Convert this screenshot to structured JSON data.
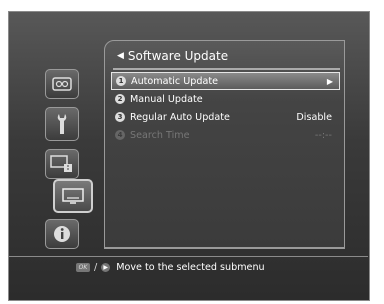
{
  "panel": {
    "title": "Software Update"
  },
  "menu": {
    "items": [
      {
        "num": "1",
        "label": "Automatic Update",
        "value": "▶"
      },
      {
        "num": "2",
        "label": "Manual Update",
        "value": ""
      },
      {
        "num": "3",
        "label": "Regular Auto Update",
        "value": "Disable"
      },
      {
        "num": "4",
        "label": "Search Time",
        "value": "--:--"
      }
    ]
  },
  "categories": [
    {
      "icon": "video-icon"
    },
    {
      "icon": "wrench-icon"
    },
    {
      "icon": "network-icon"
    },
    {
      "icon": "tv-icon"
    },
    {
      "icon": "info-icon"
    }
  ],
  "hint": {
    "ok": "OK",
    "slash": "/",
    "right": "▶",
    "text": "Move to the selected submenu"
  },
  "colors": {
    "background": "#3a3a3a",
    "highlight": "#8a8a8a",
    "text": "#ffffff",
    "disabled": "#777777"
  }
}
